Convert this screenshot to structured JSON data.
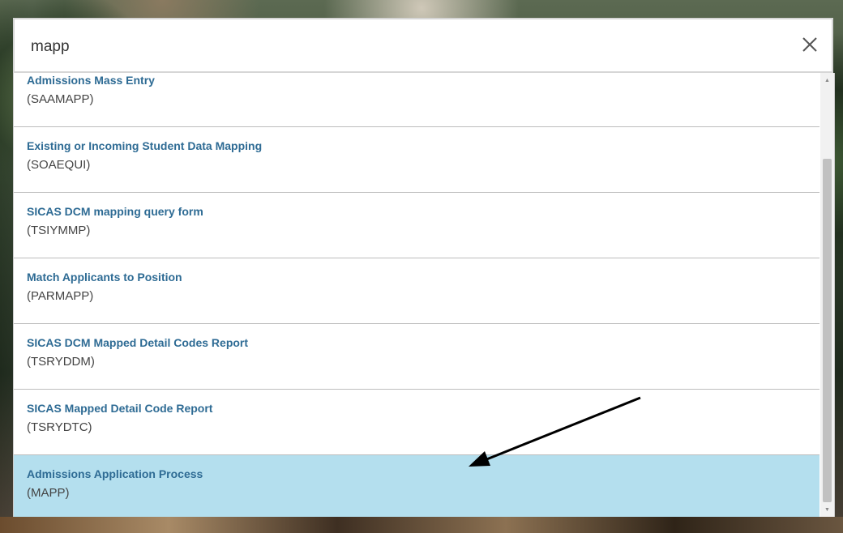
{
  "search": {
    "value": "mapp",
    "close_icon": "close-icon"
  },
  "results": [
    {
      "title": "Admissions Mass Entry",
      "code": "(SAAMAPP)"
    },
    {
      "title": "Existing or Incoming Student Data Mapping",
      "code": "(SOAEQUI)"
    },
    {
      "title": "SICAS DCM mapping query form",
      "code": "(TSIYMMP)"
    },
    {
      "title": "Match Applicants to Position",
      "code": "(PARMAPP)"
    },
    {
      "title": "SICAS DCM Mapped Detail Codes Report",
      "code": "(TSRYDDM)"
    },
    {
      "title": "SICAS Mapped Detail Code Report",
      "code": "(TSRYDTC)"
    },
    {
      "title": "Admissions Application Process",
      "code": "(MAPP)",
      "highlighted": true
    }
  ],
  "colors": {
    "highlight": "#b4dfee",
    "title": "#2e6b94",
    "annotation_arrow": "#000000"
  },
  "annotation": {
    "icon": "arrow-annotation-icon"
  }
}
